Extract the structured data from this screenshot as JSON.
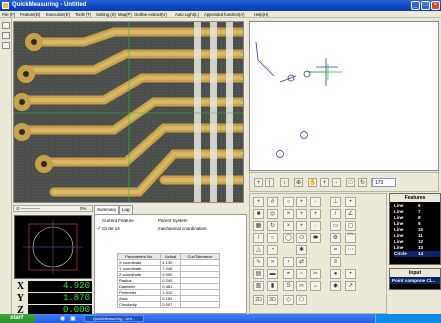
{
  "window": {
    "title": "QuickMeasuring - Untitled",
    "buttons": {
      "minimize": "_",
      "maximize": "□",
      "close": "×"
    }
  },
  "menu": [
    "File (F)",
    "Feature(D)",
    "Execution(E)",
    "Tools (T)",
    "Setting (S)",
    "Map(P)",
    "Outline extract(U)",
    "Auto Light(L)",
    "Appended function(A)",
    "Help(H)"
  ],
  "toolbar": {
    "zoom_value": "173"
  },
  "dro": {
    "zoom_percent": "0%",
    "axes": [
      {
        "label": "X",
        "value": "4.920"
      },
      {
        "label": "Y",
        "value": "1.870"
      },
      {
        "label": "Z",
        "value": "0.000"
      }
    ]
  },
  "summary": {
    "tabs": [
      "Summary",
      "Log"
    ],
    "current_feature_label": "Current Feature",
    "current_feature_value": "Circle  14",
    "parent_system_label": "Parent System",
    "parent_system_value": "mechanical coordination",
    "table": {
      "headers": [
        "Parameters No.",
        "Actual",
        "Cur/Tolerance"
      ],
      "rows": [
        [
          "X coordinate",
          "4.130",
          ""
        ],
        [
          "Y coordinate",
          "7.246",
          ""
        ],
        [
          "Z coordinate",
          "0.000",
          ""
        ],
        [
          "Radius",
          "0.240",
          ""
        ],
        [
          "Diameter",
          "0.481",
          ""
        ],
        [
          "Perimeter",
          "1.510",
          ""
        ],
        [
          "Area",
          "0.182",
          ""
        ],
        [
          "Circularity",
          "0.007",
          ""
        ]
      ]
    }
  },
  "features": {
    "title": "Features",
    "items": [
      {
        "name": "Line",
        "num": "6"
      },
      {
        "name": "Line",
        "num": "7"
      },
      {
        "name": "Line",
        "num": "8"
      },
      {
        "name": "Line",
        "num": "9"
      },
      {
        "name": "Line",
        "num": "10"
      },
      {
        "name": "Line",
        "num": "11"
      },
      {
        "name": "Line",
        "num": "12"
      },
      {
        "name": "Line",
        "num": "13"
      },
      {
        "name": "Circle",
        "num": "14"
      }
    ]
  },
  "input": {
    "title": "Input",
    "value": "Point compone  Cl..."
  },
  "taskbar": {
    "start": "start",
    "task": "QuickMeasuring - Unt...",
    "clock": ""
  },
  "colors": {
    "title_bar": "#0b47c0",
    "dro_text": "#2ee82e",
    "pcb_gold": "#c8a24a"
  }
}
